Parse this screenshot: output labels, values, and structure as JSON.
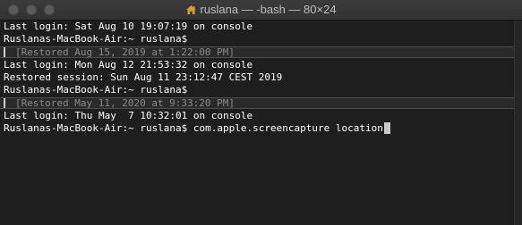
{
  "window": {
    "title": "ruslana — -bash — 80×24",
    "title_icon": "home-icon"
  },
  "terminal": {
    "lines": [
      "Last login: Sat Aug 10 19:07:19 on console",
      "Ruslanas-MacBook-Air:~ ruslana$",
      "[Restored Aug 15, 2019 at 1:22:00 PM]",
      "Last login: Mon Aug 12 21:53:32 on console",
      "Restored session: Sun Aug 11 23:12:47 CEST 2019",
      "Ruslanas-MacBook-Air:~ ruslana$",
      "[Restored May 11, 2020 at 9:33:20 PM]",
      "Last login: Thu May  7 10:32:01 on console"
    ],
    "prompt": "Ruslanas-MacBook-Air:~ ruslana$",
    "current_input": " com.apple.screencapture location"
  },
  "colors": {
    "background": "#1e1e1e",
    "foreground": "#ffffff",
    "restored_text": "#8a8a8a"
  }
}
